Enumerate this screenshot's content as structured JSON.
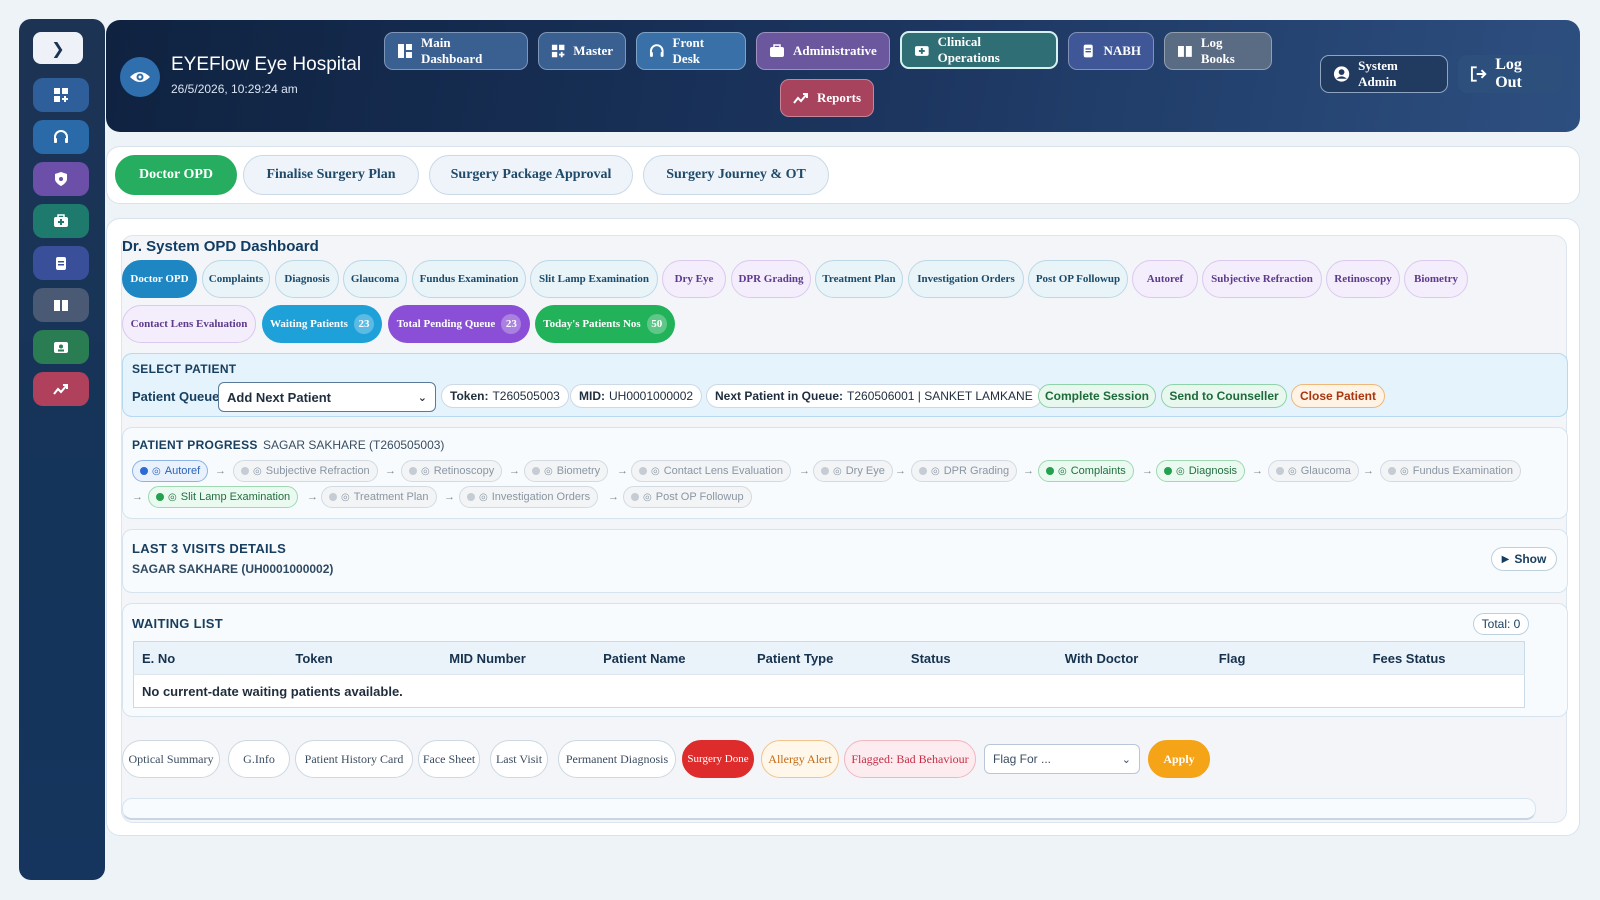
{
  "header": {
    "hospital_name": "EYEFlow Eye Hospital",
    "datetime": "26/5/2026, 10:29:24 am",
    "nav": [
      {
        "label": "Main Dashboard",
        "icon": "dashboard-icon"
      },
      {
        "label": "Master",
        "icon": "grid-plus-icon"
      },
      {
        "label": "Front Desk",
        "icon": "headset-icon"
      },
      {
        "label": "Administrative",
        "icon": "briefcase-icon"
      },
      {
        "label": "Clinical Operations",
        "icon": "medkit-icon"
      },
      {
        "label": "NABH",
        "icon": "clipboard-icon"
      },
      {
        "label": "Log Books",
        "icon": "book-icon"
      },
      {
        "label": "Reports",
        "icon": "chart-icon"
      }
    ],
    "user": "System Admin",
    "logout": "Log Out"
  },
  "tabs": [
    "Doctor OPD",
    "Finalise Surgery Plan",
    "Surgery Package Approval",
    "Surgery Journey & OT"
  ],
  "dashboard": {
    "title": "Dr. System OPD Dashboard",
    "pills": [
      "Doctor OPD",
      "Complaints",
      "Diagnosis",
      "Glaucoma",
      "Fundus Examination",
      "Slit Lamp Examination",
      "Dry Eye",
      "DPR Grading",
      "Treatment Plan",
      "Investigation Orders",
      "Post OP Followup",
      "Autoref",
      "Subjective Refraction",
      "Retinoscopy",
      "Biometry",
      "Contact Lens Evaluation"
    ],
    "counters": [
      {
        "label": "Waiting Patients",
        "count": "23",
        "color": "#1ea0d8"
      },
      {
        "label": "Total Pending Queue",
        "count": "23",
        "color": "#8a4fd6"
      },
      {
        "label": "Today's Patients Nos",
        "count": "50",
        "color": "#22b35a"
      }
    ]
  },
  "select_patient": {
    "title": "SELECT PATIENT",
    "queue_label": "Patient Queue",
    "queue_value": "Add Next Patient",
    "token_label": "Token:",
    "token": "T260505003",
    "mid_label": "MID:",
    "mid": "UH0001000002",
    "next_label": "Next Patient in Queue:",
    "next_value": "T260506001 | SANKET LAMKANE",
    "actions": [
      "Complete Session",
      "Send to Counseller",
      "Close Patient"
    ]
  },
  "progress": {
    "title": "PATIENT PROGRESS",
    "patient": "SAGAR SAKHARE (T260505003)",
    "steps": [
      {
        "label": "Autoref",
        "state": "current"
      },
      {
        "label": "Subjective Refraction",
        "state": "pending"
      },
      {
        "label": "Retinoscopy",
        "state": "pending"
      },
      {
        "label": "Biometry",
        "state": "pending"
      },
      {
        "label": "Contact Lens Evaluation",
        "state": "pending"
      },
      {
        "label": "Dry Eye",
        "state": "pending"
      },
      {
        "label": "DPR Grading",
        "state": "pending"
      },
      {
        "label": "Complaints",
        "state": "done"
      },
      {
        "label": "Diagnosis",
        "state": "done"
      },
      {
        "label": "Glaucoma",
        "state": "pending"
      },
      {
        "label": "Fundus Examination",
        "state": "pending"
      },
      {
        "label": "Slit Lamp Examination",
        "state": "done"
      },
      {
        "label": "Treatment Plan",
        "state": "pending"
      },
      {
        "label": "Investigation Orders",
        "state": "pending"
      },
      {
        "label": "Post OP Followup",
        "state": "pending"
      }
    ]
  },
  "visits": {
    "title": "LAST 3 VISITS DETAILS",
    "patient": "SAGAR SAKHARE (UH0001000002)",
    "show_label": "Show"
  },
  "waiting": {
    "title": "WAITING LIST",
    "total": "Total: 0",
    "columns": [
      "E. No",
      "Token",
      "MID Number",
      "Patient Name",
      "Patient Type",
      "Status",
      "With Doctor",
      "Flag",
      "Fees Status"
    ],
    "empty": "No current-date waiting patients available."
  },
  "bottom": {
    "buttons": [
      "Optical Summary",
      "G.Info",
      "Patient History Card",
      "Face Sheet",
      "Last Visit",
      "Permanent Diagnosis",
      "Surgery Done",
      "Allergy Alert",
      "Flagged: Bad Behaviour"
    ],
    "flag_placeholder": "Flag For ...",
    "apply": "Apply"
  }
}
